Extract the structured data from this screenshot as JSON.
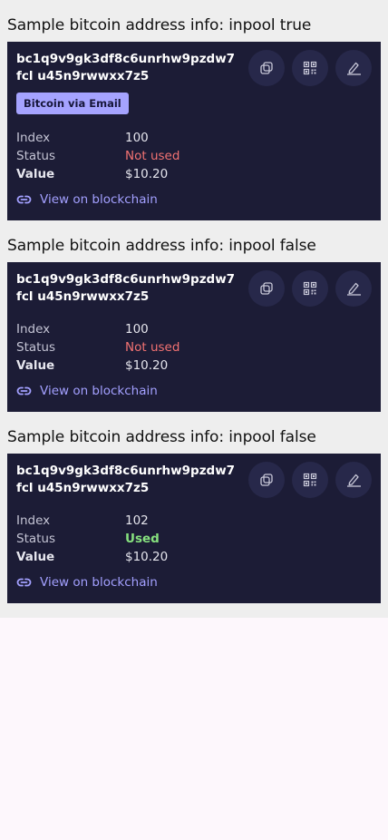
{
  "sections": [
    {
      "title": "Sample bitcoin address info: inpool true",
      "address": "bc1q9v9gk3df8c6unrhw9pzdw7fcl u45n9rwwxx7z5",
      "badge": "Bitcoin via Email",
      "rows": {
        "index_label": "Index",
        "index_value": "100",
        "status_label": "Status",
        "status_value": "Not used",
        "value_label": "Value",
        "value_value": "$10.20"
      },
      "link": "View on blockchain"
    },
    {
      "title": "Sample bitcoin address info: inpool false",
      "address": "bc1q9v9gk3df8c6unrhw9pzdw7fcl u45n9rwwxx7z5",
      "rows": {
        "index_label": "Index",
        "index_value": "100",
        "status_label": "Status",
        "status_value": "Not used",
        "value_label": "Value",
        "value_value": "$10.20"
      },
      "link": "View on blockchain"
    },
    {
      "title": "Sample bitcoin address info: inpool false",
      "address": "bc1q9v9gk3df8c6unrhw9pzdw7fcl u45n9rwwxx7z5",
      "rows": {
        "index_label": "Index",
        "index_value": "102",
        "status_label": "Status",
        "status_value": "Used",
        "value_label": "Value",
        "value_value": "$10.20"
      },
      "link": "View on blockchain"
    }
  ],
  "icons": {
    "copy": "copy-icon",
    "qr": "qr-code-icon",
    "edit": "edit-pencil-icon",
    "link": "link-icon"
  },
  "colors": {
    "card_background": "#1c1c36",
    "badge_background": "#a5a3ff",
    "link": "#a3a0ff",
    "not_used": "#f27272",
    "used": "#86e07e"
  }
}
